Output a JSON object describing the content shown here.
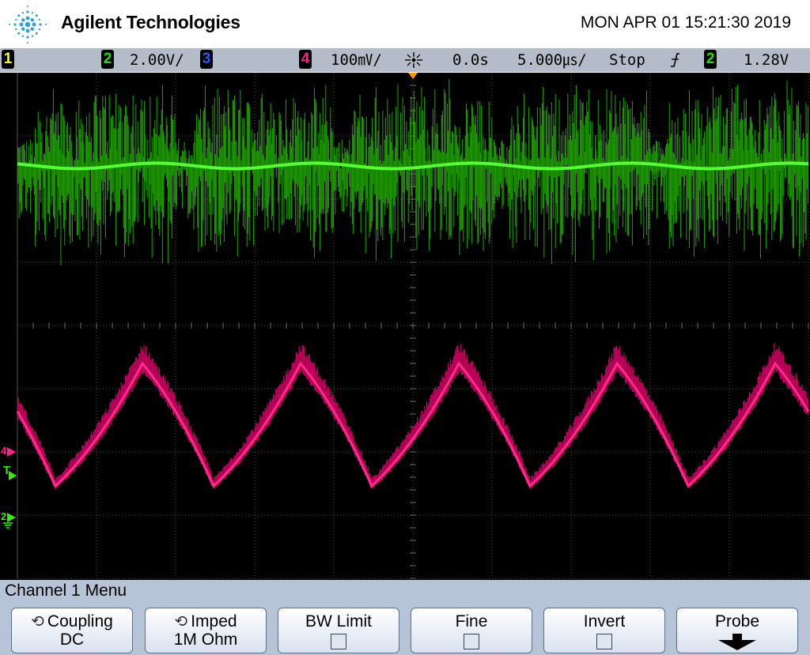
{
  "header": {
    "brand": "Agilent Technologies",
    "datetime": "MON APR 01 15:21:30 2019"
  },
  "statusbar": {
    "ch1_label": "1",
    "ch2_label": "2",
    "ch2_scale": "2.00V/",
    "ch3_label": "3",
    "ch4_label": "4",
    "ch4_scale": "100㎷/",
    "trigger_icon": "trigger-position-icon",
    "delay": "0.0s",
    "timebase": "5.000㎲/",
    "run_state": "Stop",
    "trigger_slope_icon": "falling-edge-icon",
    "trigger_source": "2",
    "trigger_level": "1.28V"
  },
  "screen": {
    "marker_ch4": "4",
    "marker_trigger": "T",
    "marker_ch2": "2"
  },
  "colors": {
    "ch1": "#ffff00",
    "ch2": "#22dd00",
    "ch2_bright": "#55ff33",
    "ch3": "#3355ff",
    "ch4": "#e8107a",
    "menu_bg": "#b7c3d7",
    "statusbar_bg": "#b3bcc8"
  },
  "menu": {
    "title": "Channel 1  Menu",
    "softkeys": [
      {
        "label": "Coupling",
        "value": "DC",
        "icon": "rotate-knob-icon"
      },
      {
        "label": "Imped",
        "value": "1M Ohm",
        "icon": "rotate-knob-icon"
      },
      {
        "label": "BW Limit",
        "state": "unchecked"
      },
      {
        "label": "Fine",
        "state": "unchecked"
      },
      {
        "label": "Invert",
        "state": "unchecked"
      },
      {
        "label": "Probe",
        "icon": "down-arrow-icon"
      }
    ]
  }
}
